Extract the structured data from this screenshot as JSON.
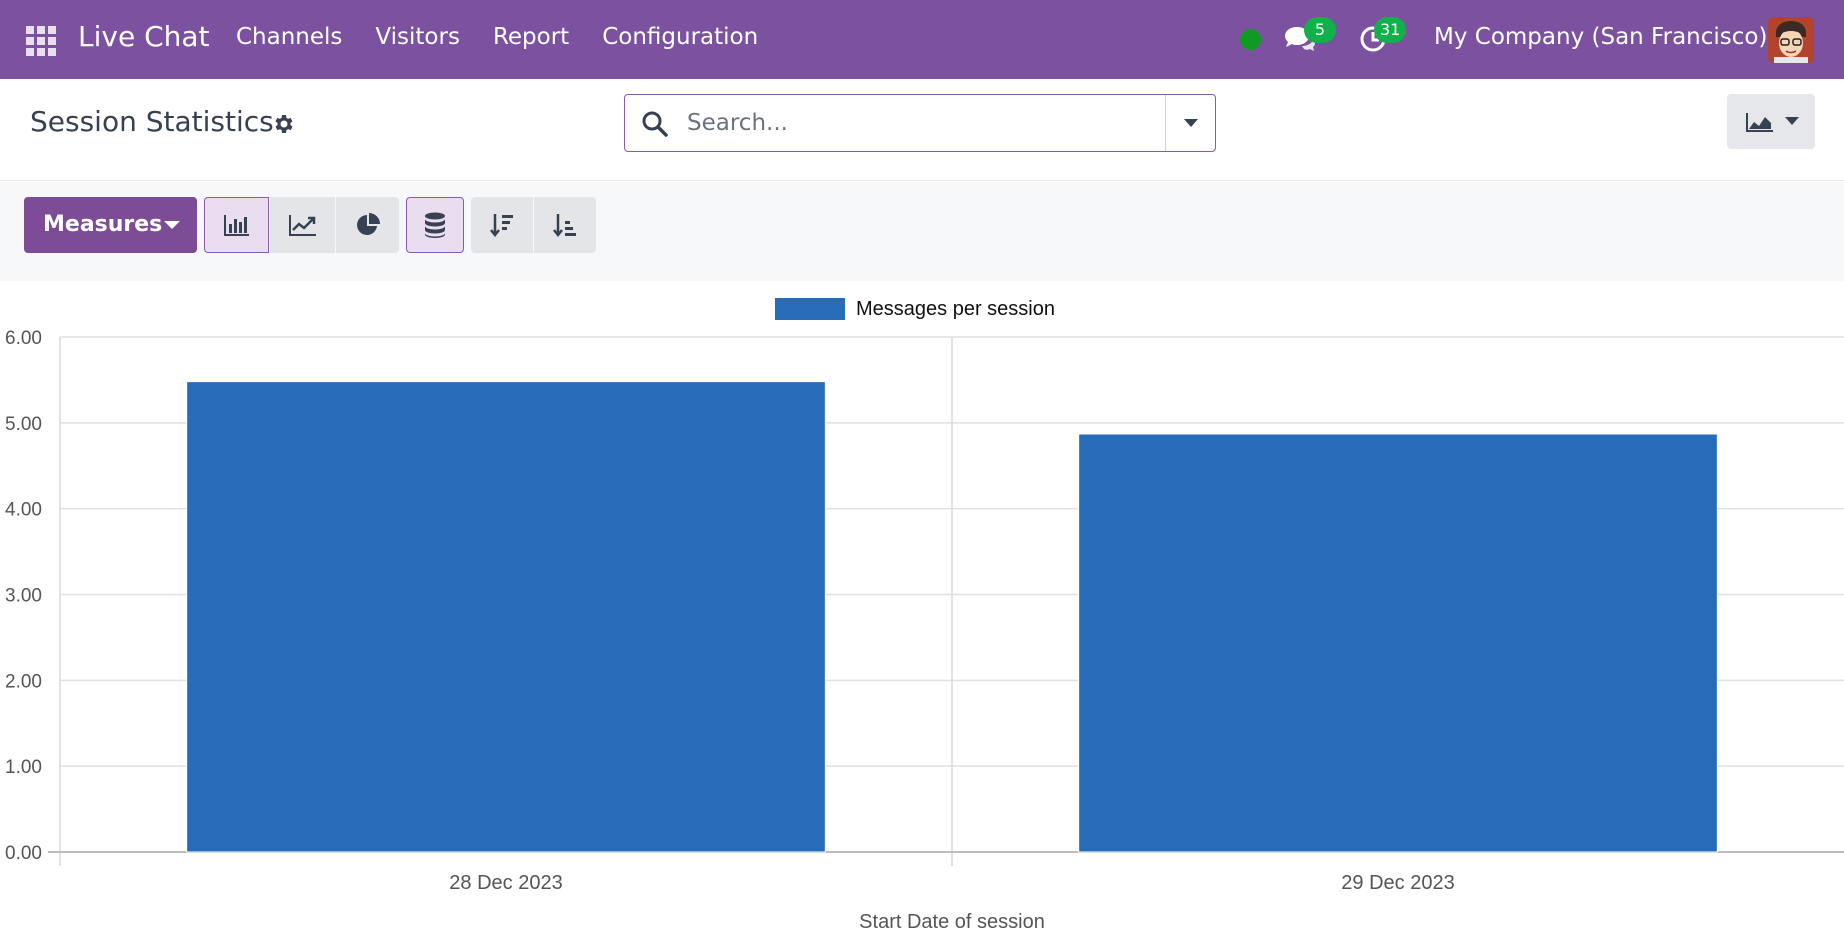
{
  "navbar": {
    "brand": "Live Chat",
    "menu": [
      "Channels",
      "Visitors",
      "Report",
      "Configuration"
    ],
    "chat_count": "5",
    "activity_count": "31",
    "company": "My Company (San Francisco)",
    "icons": [
      "apps-grid-icon",
      "chat-icon",
      "clock-icon",
      "avatar"
    ]
  },
  "control": {
    "title": "Session Statistics",
    "search_placeholder": "Search..."
  },
  "toolbar": {
    "measures_label": "Measures",
    "buttons": [
      "bar-chart-icon",
      "line-chart-icon",
      "pie-chart-icon",
      "stacked-icon",
      "sort-descending-icon",
      "sort-ascending-icon"
    ]
  },
  "chart_data": {
    "type": "bar",
    "categories": [
      "28 Dec 2023",
      "29 Dec 2023"
    ],
    "series": [
      {
        "name": "Messages per session",
        "values": [
          5.48,
          4.87
        ],
        "color": "#276cb8"
      }
    ],
    "xlabel": "Start Date of session",
    "ylabel": "",
    "ylim": [
      0,
      6
    ],
    "yticks": [
      "0.00",
      "1.00",
      "2.00",
      "3.00",
      "4.00",
      "5.00",
      "6.00"
    ],
    "grid": true,
    "legend": "top-center"
  }
}
